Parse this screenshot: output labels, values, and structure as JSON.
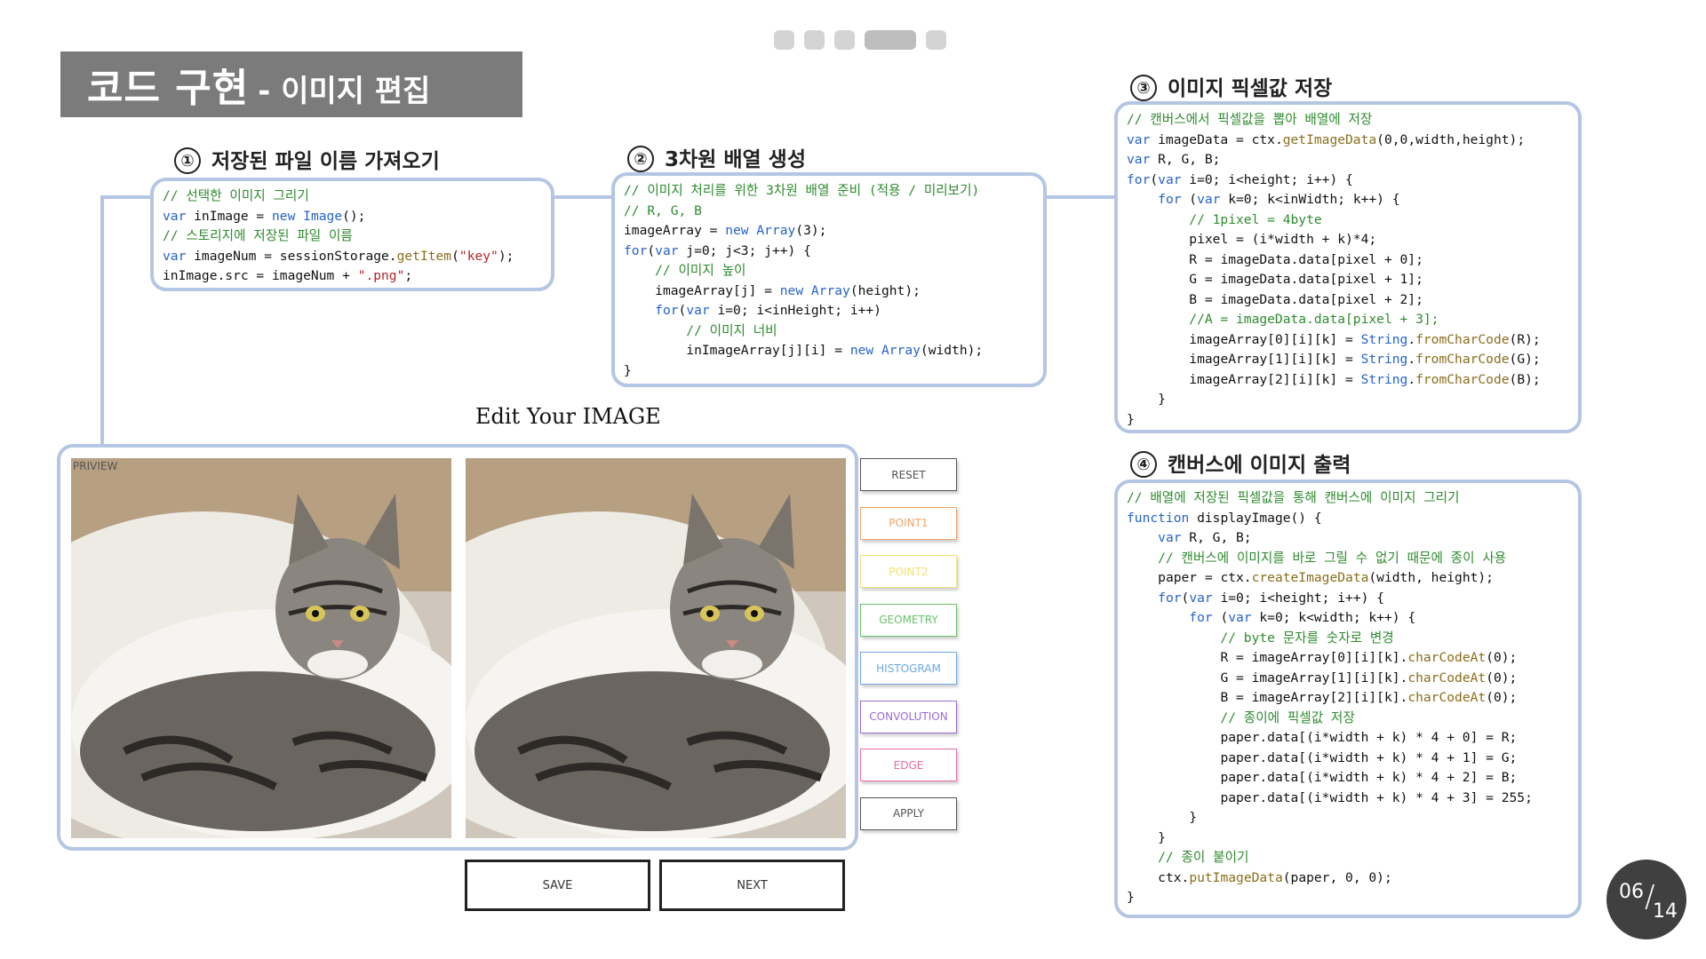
{
  "pager": {
    "dot_count": 5,
    "active_index": 3
  },
  "title": {
    "main": "코드 구현",
    "sub": "- 이미지 편집"
  },
  "sections": {
    "s1": {
      "num": "①",
      "title": "저장된 파일 이름 가져오기"
    },
    "s2": {
      "num": "②",
      "title": "3차원 배열 생성"
    },
    "s3": {
      "num": "③",
      "title": "이미지 픽셀값 저장"
    },
    "s4": {
      "num": "④",
      "title": "캔버스에 이미지 출력"
    }
  },
  "code1": [
    {
      "indent": 0,
      "text": "// 선택한 이미지 그리기",
      "type": "comment"
    },
    {
      "indent": 0,
      "text": "var inImage = new Image();",
      "type": "code"
    },
    {
      "indent": 0,
      "text": "// 스토리지에 저장된 파일 이름",
      "type": "comment"
    },
    {
      "indent": 0,
      "text": "var imageNum = sessionStorage.getItem(\"key\");",
      "type": "code"
    },
    {
      "indent": 0,
      "text": "inImage.src = imageNum + \".png\";",
      "type": "code"
    }
  ],
  "code2": [
    {
      "indent": 0,
      "text": "// 이미지 처리를 위한 3차원 배열 준비 (적용 / 미리보기)",
      "type": "comment"
    },
    {
      "indent": 0,
      "text": "// R, G, B",
      "type": "comment"
    },
    {
      "indent": 0,
      "text": "imageArray = new Array(3);",
      "type": "code"
    },
    {
      "indent": 0,
      "text": "for(var j=0; j<3; j++) {",
      "type": "code"
    },
    {
      "indent": 1,
      "text": "// 이미지 높이",
      "type": "comment"
    },
    {
      "indent": 1,
      "text": "imageArray[j] = new Array(height);",
      "type": "code"
    },
    {
      "indent": 1,
      "text": "for(var i=0; i<inHeight; i++)",
      "type": "code"
    },
    {
      "indent": 2,
      "text": "// 이미지 너비",
      "type": "comment"
    },
    {
      "indent": 2,
      "text": "inImageArray[j][i] = new Array(width);",
      "type": "code"
    },
    {
      "indent": 0,
      "text": "}",
      "type": "code"
    }
  ],
  "code3": [
    {
      "indent": 0,
      "text": "// 캔버스에서 픽셀값을 뽑아 배열에 저장",
      "type": "comment"
    },
    {
      "indent": 0,
      "text": "var imageData = ctx.getImageData(0,0,width,height);",
      "type": "code"
    },
    {
      "indent": 0,
      "text": "var R, G, B;",
      "type": "code"
    },
    {
      "indent": 0,
      "text": "for(var i=0; i<height; i++) {",
      "type": "code"
    },
    {
      "indent": 1,
      "text": "for (var k=0; k<inWidth; k++) {",
      "type": "code"
    },
    {
      "indent": 2,
      "text": "// 1pixel = 4byte",
      "type": "comment"
    },
    {
      "indent": 2,
      "text": "pixel = (i*width + k)*4;",
      "type": "code"
    },
    {
      "indent": 2,
      "text": "R = imageData.data[pixel + 0];",
      "type": "code"
    },
    {
      "indent": 2,
      "text": "G = imageData.data[pixel + 1];",
      "type": "code"
    },
    {
      "indent": 2,
      "text": "B = imageData.data[pixel + 2];",
      "type": "code"
    },
    {
      "indent": 2,
      "text": "//A = imageData.data[pixel + 3];",
      "type": "comment"
    },
    {
      "indent": 2,
      "text": "imageArray[0][i][k] = String.fromCharCode(R);",
      "type": "code"
    },
    {
      "indent": 2,
      "text": "imageArray[1][i][k] = String.fromCharCode(G);",
      "type": "code"
    },
    {
      "indent": 2,
      "text": "imageArray[2][i][k] = String.fromCharCode(B);",
      "type": "code"
    },
    {
      "indent": 1,
      "text": "}",
      "type": "code"
    },
    {
      "indent": 0,
      "text": "}",
      "type": "code"
    }
  ],
  "code4": [
    {
      "indent": 0,
      "text": "// 배열에 저장된 픽셀값을 통해 캔버스에 이미지 그리기",
      "type": "comment"
    },
    {
      "indent": 0,
      "text": "function displayImage() {",
      "type": "code"
    },
    {
      "indent": 1,
      "text": "var R, G, B;",
      "type": "code"
    },
    {
      "indent": 1,
      "text": "// 캔버스에 이미지를 바로 그릴 수 없기 때문에 종이 사용",
      "type": "comment"
    },
    {
      "indent": 1,
      "text": "paper = ctx.createImageData(width, height);",
      "type": "code"
    },
    {
      "indent": 1,
      "text": "for(var i=0; i<height; i++) {",
      "type": "code"
    },
    {
      "indent": 2,
      "text": "for (var k=0; k<width; k++) {",
      "type": "code"
    },
    {
      "indent": 3,
      "text": "// byte 문자를 숫자로 변경",
      "type": "comment"
    },
    {
      "indent": 3,
      "text": "R = imageArray[0][i][k].charCodeAt(0);",
      "type": "code"
    },
    {
      "indent": 3,
      "text": "G = imageArray[1][i][k].charCodeAt(0);",
      "type": "code"
    },
    {
      "indent": 3,
      "text": "B = imageArray[2][i][k].charCodeAt(0);",
      "type": "code"
    },
    {
      "indent": 3,
      "text": "// 종이에 픽셀값 저장",
      "type": "comment"
    },
    {
      "indent": 3,
      "text": "paper.data[(i*width + k) * 4 + 0] = R;",
      "type": "code"
    },
    {
      "indent": 3,
      "text": "paper.data[(i*width + k) * 4 + 1] = G;",
      "type": "code"
    },
    {
      "indent": 3,
      "text": "paper.data[(i*width + k) * 4 + 2] = B;",
      "type": "code"
    },
    {
      "indent": 3,
      "text": "paper.data[(i*width + k) * 4 + 3] = 255;",
      "type": "code"
    },
    {
      "indent": 2,
      "text": "}",
      "type": "code"
    },
    {
      "indent": 1,
      "text": "}",
      "type": "code"
    },
    {
      "indent": 1,
      "text": "// 종이 붙이기",
      "type": "comment"
    },
    {
      "indent": 1,
      "text": "ctx.putImageData(paper, 0, 0);",
      "type": "code"
    },
    {
      "indent": 0,
      "text": "}",
      "type": "code"
    }
  ],
  "syntax_colors": {
    "comment": "#2e8b2e",
    "keyword": "#2563c9",
    "string": "#b5262a",
    "method": "#8a6d1c",
    "default": "#111111"
  },
  "editor": {
    "heading": "Edit Your IMAGE",
    "preview_label": "PRIVIEW",
    "buttons": [
      {
        "label": "RESET",
        "color": "#555555"
      },
      {
        "label": "POINT1",
        "color": "#f0a36a"
      },
      {
        "label": "POINT2",
        "color": "#f2e07a"
      },
      {
        "label": "GEOMETRY",
        "color": "#66c266"
      },
      {
        "label": "HISTOGRAM",
        "color": "#6aa8e6"
      },
      {
        "label": "CONVOLUTION",
        "color": "#9b6ad6"
      },
      {
        "label": "EDGE",
        "color": "#e86aa6"
      },
      {
        "label": "APPLY",
        "color": "#555555"
      }
    ],
    "save_label": "SAVE",
    "next_label": "NEXT"
  },
  "page": {
    "current": "06",
    "total": "14"
  },
  "accent": {
    "box_border": "#b5c6e4",
    "title_bg": "#7b7b7b",
    "counter_bg": "#404040"
  }
}
